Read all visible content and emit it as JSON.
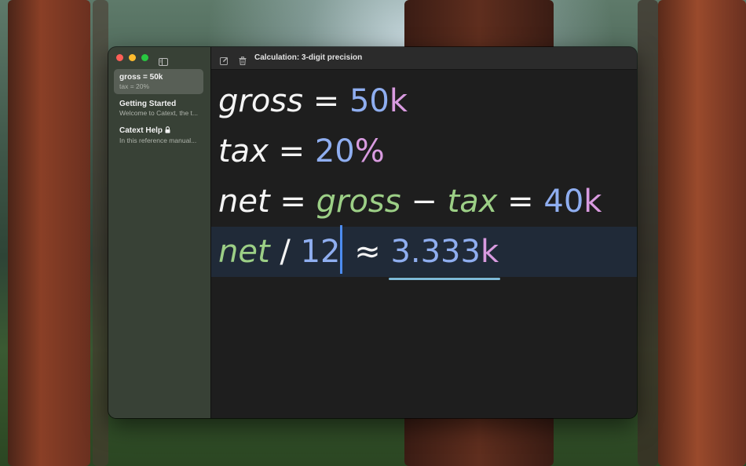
{
  "window": {
    "title": "Calculation: 3-digit precision"
  },
  "sidebar": {
    "notes": [
      {
        "title": "gross = 50k",
        "preview": "tax = 20%",
        "selected": true,
        "locked": false
      },
      {
        "title": "Getting Started",
        "preview": "Welcome to Catext, the t...",
        "selected": false,
        "locked": false
      },
      {
        "title": "Catext Help",
        "preview": "In this reference manual...",
        "selected": false,
        "locked": true
      }
    ]
  },
  "editor": {
    "lines": [
      {
        "def": "gross",
        "eq": "=",
        "num": "50",
        "unit": "k"
      },
      {
        "def": "tax",
        "eq": "=",
        "num": "20",
        "unit": "%"
      },
      {
        "def": "net",
        "eq": "=",
        "ref1": "gross",
        "minus": "−",
        "ref2": "tax",
        "eq2": "=",
        "result_num": "40",
        "result_unit": "k"
      },
      {
        "ref": "net",
        "div": "/",
        "num": "12",
        "approx": "≈",
        "result_num": "3.333",
        "result_unit": "k"
      }
    ]
  },
  "colors": {
    "variable_reference": "#9ccf86",
    "number": "#8faef0",
    "unit": "#d99be0",
    "result_underline": "#7dbad8",
    "caret": "#4d8cf0",
    "active_line": "#202a38"
  },
  "icons": {
    "toolbar": [
      "sidebar-toggle-icon",
      "compose-icon",
      "trash-icon"
    ],
    "locked_note": "lock-icon"
  }
}
